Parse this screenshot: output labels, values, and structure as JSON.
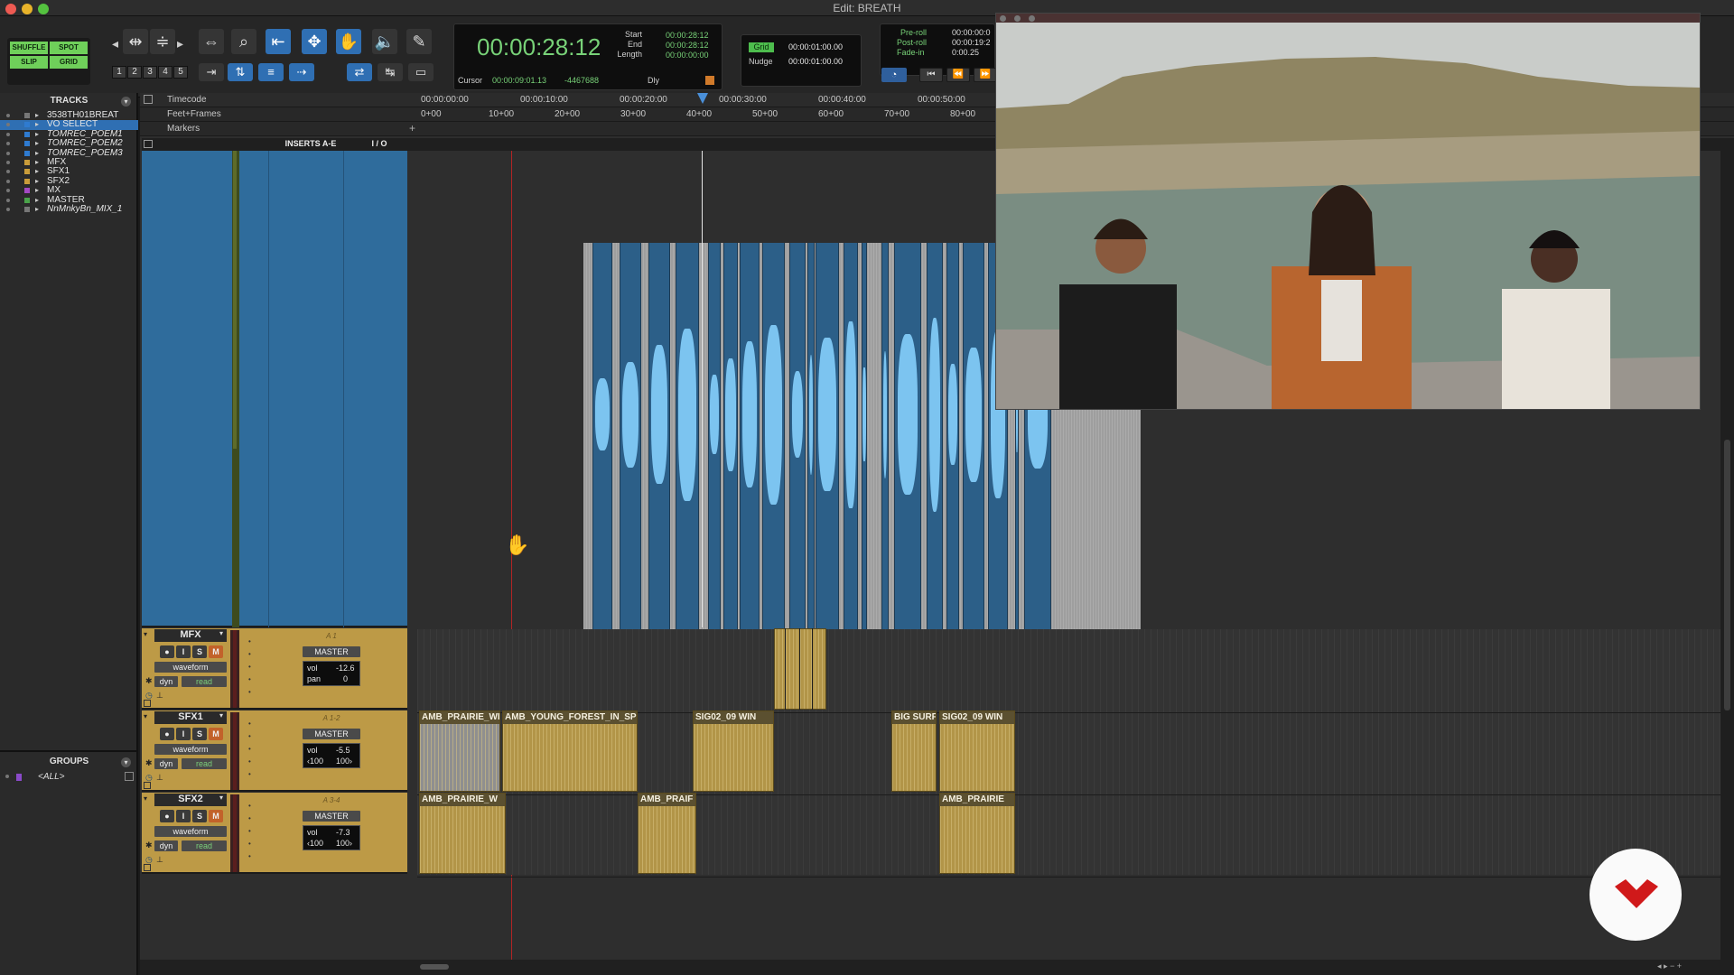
{
  "window": {
    "title": "Edit: BREATH"
  },
  "modes": {
    "shuffle": "SHUFFLE",
    "spot": "SPOT",
    "slip": "SLIP",
    "grid": "GRID"
  },
  "zoom_presets": [
    "1",
    "2",
    "3",
    "4",
    "5"
  ],
  "counter": {
    "main": "00:00:28:12",
    "start_label": "Start",
    "start": "00:00:28:12",
    "end_label": "End",
    "end": "00:00:28:12",
    "length_label": "Length",
    "length": "00:00:00:00",
    "cursor_label": "Cursor",
    "cursor": "00:00:09:01.13",
    "cursor_sample": "-4467688",
    "dly": "Dly"
  },
  "grid_nudge": {
    "grid_label": "Grid",
    "grid_value": "00:00:01:00.00",
    "nudge_label": "Nudge",
    "nudge_value": "00:00:01:00.00"
  },
  "preroll": {
    "preroll_label": "Pre-roll",
    "preroll_value": "00:00:00:0",
    "postroll_label": "Post-roll",
    "postroll_value": "00:00:19:2",
    "fadein_label": "Fade-in",
    "fadein_value": "0:00.25"
  },
  "tracks_panel": {
    "title": "TRACKS",
    "items": [
      {
        "name": "3538TH01BREAT",
        "color": "#777777",
        "selected": false,
        "italic": false
      },
      {
        "name": "VO SELECT",
        "color": "#2f7bd0",
        "selected": true,
        "italic": false
      },
      {
        "name": "TOMREC_POEM1",
        "color": "#2f7bd0",
        "selected": false,
        "italic": true
      },
      {
        "name": "TOMREC_POEM2",
        "color": "#2f7bd0",
        "selected": false,
        "italic": true
      },
      {
        "name": "TOMREC_POEM3",
        "color": "#2f7bd0",
        "selected": false,
        "italic": true
      },
      {
        "name": "MFX",
        "color": "#c99c3a",
        "selected": false,
        "italic": false
      },
      {
        "name": "SFX1",
        "color": "#c99c3a",
        "selected": false,
        "italic": false
      },
      {
        "name": "SFX2",
        "color": "#c99c3a",
        "selected": false,
        "italic": false
      },
      {
        "name": "MX",
        "color": "#a349c2",
        "selected": false,
        "italic": false
      },
      {
        "name": "MASTER",
        "color": "#4aa34a",
        "selected": false,
        "italic": false
      },
      {
        "name": "NnMnkyBn_MIX_1",
        "color": "#777777",
        "selected": false,
        "italic": true
      }
    ]
  },
  "groups_panel": {
    "title": "GROUPS",
    "items": [
      "<ALL>"
    ]
  },
  "rulers": {
    "timecode_label": "Timecode",
    "feet_label": "Feet+Frames",
    "markers_label": "Markers",
    "timecode_ticks": [
      "00:00:00:00",
      "00:00:10:00",
      "00:00:20:00",
      "00:00:30:00",
      "00:00:40:00",
      "00:00:50:00"
    ],
    "feet_ticks": [
      "0+00",
      "10+00",
      "20+00",
      "30+00",
      "40+00",
      "50+00",
      "60+00",
      "70+00",
      "80+00"
    ]
  },
  "column_headers": {
    "inserts": "INSERTS A-E",
    "io": "I / O"
  },
  "track_controls": {
    "record": "●",
    "input": "I",
    "solo": "S",
    "mute": "M"
  },
  "strips": [
    {
      "name": "MFX",
      "input": "A 1",
      "output": "MASTER",
      "view": "waveform",
      "dyn": "dyn",
      "auto": "read",
      "vol_label": "vol",
      "vol": "-12.6",
      "pan_label": "pan",
      "pan": "0",
      "pan_l": "",
      "pan_r": ""
    },
    {
      "name": "SFX1",
      "input": "A 1-2",
      "output": "MASTER",
      "view": "waveform",
      "dyn": "dyn",
      "auto": "read",
      "vol_label": "vol",
      "vol": "-5.5",
      "pan_label": "",
      "pan": "",
      "pan_l": "‹100",
      "pan_r": "100›"
    },
    {
      "name": "SFX2",
      "input": "A 3-4",
      "output": "MASTER",
      "view": "waveform",
      "dyn": "dyn",
      "auto": "read",
      "vol_label": "vol",
      "vol": "-7.3",
      "pan_label": "",
      "pan": "",
      "pan_l": "‹100",
      "pan_r": "100›"
    }
  ],
  "clips": {
    "sfx1": [
      "AMB_PRAIRIE_WI",
      "AMB_YOUNG_FOREST_IN_SPR",
      "SIG02_09 WIN",
      "BIG SURF",
      "SIG02_09 WIN"
    ],
    "sfx2": [
      "AMB_PRAIRIE_W",
      "AMB_PRAIF",
      "AMB_PRAIRIE"
    ]
  },
  "colors": {
    "accent_blue": "#2f7bd0",
    "track_gold": "#bd9a46",
    "clip_gold": "#b29548",
    "counter_green": "#78d278"
  }
}
